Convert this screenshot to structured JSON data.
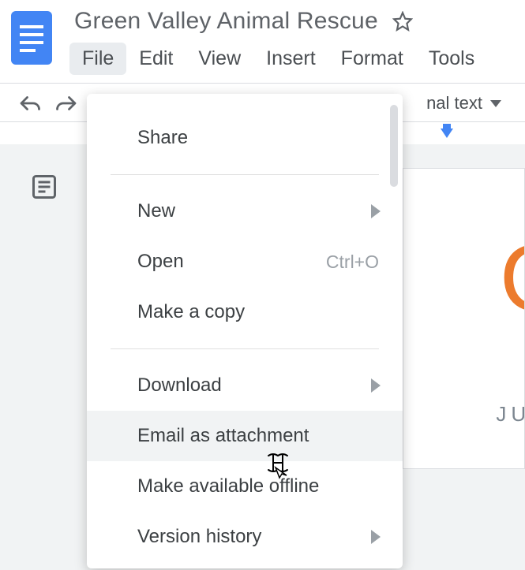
{
  "document": {
    "title": "Green Valley Animal Rescue"
  },
  "menubar": {
    "file": "File",
    "edit": "Edit",
    "view": "View",
    "insert": "Insert",
    "format": "Format",
    "tools": "Tools"
  },
  "toolbar": {
    "style_label": "nal text"
  },
  "file_menu": {
    "share": "Share",
    "new": "New",
    "open": "Open",
    "open_shortcut": "Ctrl+O",
    "make_copy": "Make a copy",
    "download": "Download",
    "email_attachment": "Email as attachment",
    "make_offline": "Make available offline",
    "version_history": "Version history"
  },
  "page_preview": {
    "big_text": "G",
    "sub_text": "JULY"
  }
}
